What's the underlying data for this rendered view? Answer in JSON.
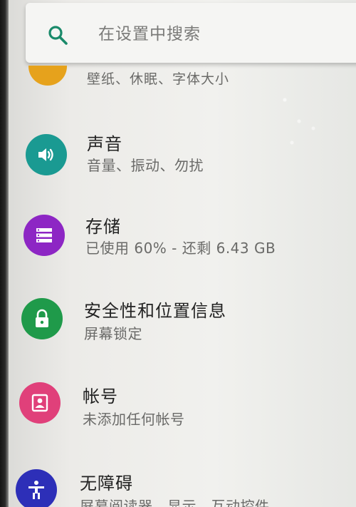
{
  "search": {
    "placeholder": "在设置中搜索"
  },
  "partial_item": {
    "subtitle": "壁纸、休眠、字体大小",
    "icon": "display-icon",
    "color": "#e6a21c"
  },
  "items": [
    {
      "title": "声音",
      "subtitle": "音量、振动、勿扰",
      "icon": "volume-icon",
      "color": "#1a9a92"
    },
    {
      "title": "存储",
      "subtitle": "已使用 60% - 还剩 6.43 GB",
      "icon": "storage-icon",
      "color": "#8d26c4"
    },
    {
      "title": "安全性和位置信息",
      "subtitle": "屏幕锁定",
      "icon": "lock-icon",
      "color": "#1f9a4a"
    },
    {
      "title": "帐号",
      "subtitle": "未添加任何帐号",
      "icon": "account-icon",
      "color": "#e0407a"
    },
    {
      "title": "无障碍",
      "subtitle": "屏幕阅读器、显示、互动控件",
      "icon": "accessibility-icon",
      "color": "#2d2fb8"
    }
  ]
}
